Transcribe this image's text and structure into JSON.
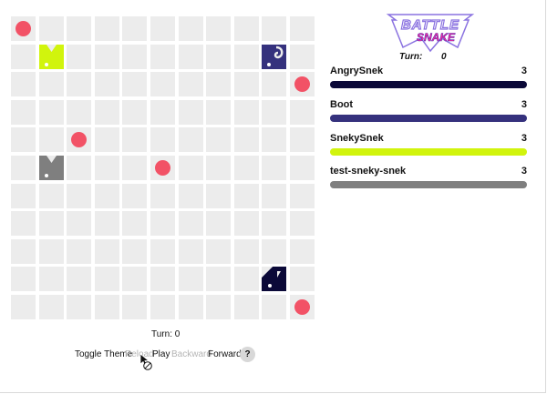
{
  "board": {
    "cols": 11,
    "rows": 11,
    "cell_color": "#ececec",
    "food_color": "#f25266",
    "food": [
      {
        "col": 0,
        "row": 0
      },
      {
        "col": 10,
        "row": 2
      },
      {
        "col": 2,
        "row": 4
      },
      {
        "col": 5,
        "row": 5
      },
      {
        "col": 10,
        "row": 10
      }
    ],
    "snakes": [
      {
        "name": "Boot",
        "color": "#35317d",
        "col": 9,
        "row": 1,
        "head": "curl"
      },
      {
        "name": "SnekySnek",
        "color": "#d1f40d",
        "col": 1,
        "row": 1,
        "head": "notch"
      },
      {
        "name": "test-sneky-snek",
        "color": "#7f7f7f",
        "col": 1,
        "row": 5,
        "head": "notch"
      },
      {
        "name": "AngrySnek",
        "color": "#0b0938",
        "col": 9,
        "row": 9,
        "head": "wedge"
      }
    ]
  },
  "logo": {
    "line1": "BATTLE",
    "line2": "SNAKE",
    "primary": "#8a72e0",
    "accent": "#ff2d9a"
  },
  "header": {
    "turn_label": "Turn:",
    "turn_value": "0"
  },
  "scoreboard": [
    {
      "name": "AngrySnek",
      "length": "3",
      "color": "#0b0938"
    },
    {
      "name": "Boot",
      "length": "3",
      "color": "#35317d"
    },
    {
      "name": "SnekySnek",
      "length": "3",
      "color": "#d1f40d"
    },
    {
      "name": "test-sneky-snek",
      "length": "3",
      "color": "#7f7f7f"
    }
  ],
  "footer": {
    "turn_text": "Turn: 0",
    "toggle_theme": "Toggle Theme",
    "reload": "Reload",
    "play": "Play",
    "backward": "Backward",
    "forward": "Forward",
    "help": "?"
  },
  "icons": {
    "help": "help-icon",
    "cursor": "not-allowed-cursor-icon"
  }
}
